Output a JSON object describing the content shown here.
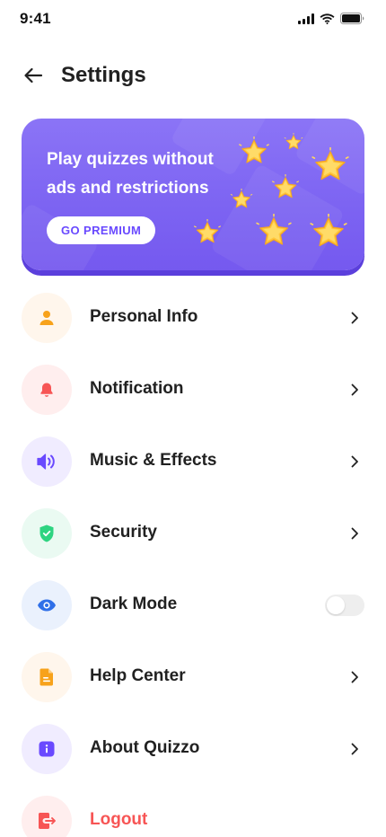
{
  "status_bar": {
    "time": "9:41"
  },
  "header": {
    "title": "Settings"
  },
  "banner": {
    "line1": "Play quizzes without",
    "line2": "ads and restrictions",
    "button_label": "GO PREMIUM"
  },
  "settings": [
    {
      "label": "Personal Info",
      "icon": "person-icon",
      "accent": "#f7a21b",
      "bg": "#fff6ec",
      "control": "chevron"
    },
    {
      "label": "Notification",
      "icon": "bell-icon",
      "accent": "#f75555",
      "bg": "#ffeeee",
      "control": "chevron"
    },
    {
      "label": "Music & Effects",
      "icon": "speaker-icon",
      "accent": "#6949ff",
      "bg": "#f0ecff",
      "control": "chevron"
    },
    {
      "label": "Security",
      "icon": "shield-check-icon",
      "accent": "#2ed481",
      "bg": "#eafaf2",
      "control": "chevron"
    },
    {
      "label": "Dark Mode",
      "icon": "eye-icon",
      "accent": "#2f6fe8",
      "bg": "#eaf1fd",
      "control": "toggle",
      "toggle_on": false
    },
    {
      "label": "Help Center",
      "icon": "document-icon",
      "accent": "#f7a21b",
      "bg": "#fff6ec",
      "control": "chevron"
    },
    {
      "label": "About Quizzo",
      "icon": "info-icon",
      "accent": "#6949ff",
      "bg": "#f0ecff",
      "control": "chevron"
    },
    {
      "label": "Logout",
      "icon": "logout-icon",
      "accent": "#f75555",
      "bg": "#ffeeee",
      "control": "none"
    }
  ],
  "colors": {
    "primary": "#6949ff",
    "banner_bg": "#7c63f2",
    "danger": "#f75555",
    "star": "#ffc83d"
  }
}
